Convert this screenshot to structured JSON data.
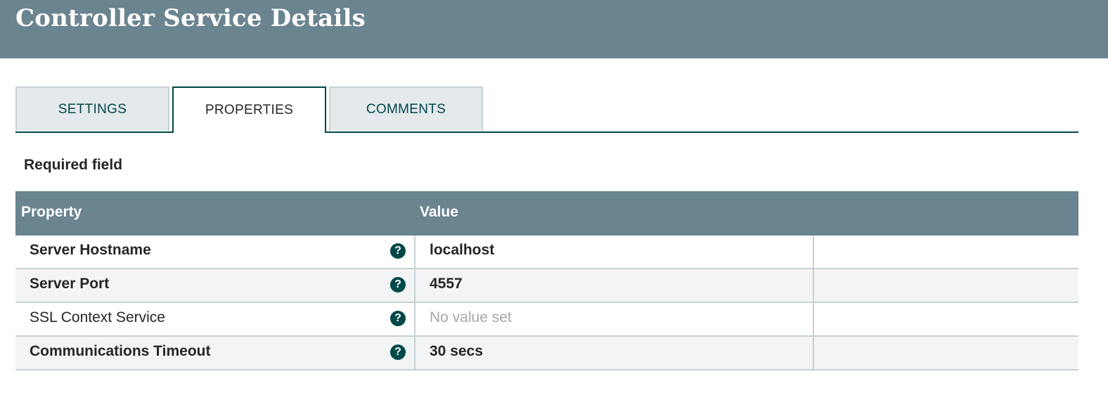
{
  "header": {
    "title": "Controller Service Details"
  },
  "tabs": [
    {
      "label": "SETTINGS",
      "active": false
    },
    {
      "label": "PROPERTIES",
      "active": true
    },
    {
      "label": "COMMENTS",
      "active": false
    }
  ],
  "required_field_label": "Required field",
  "table": {
    "columns": [
      "Property",
      "Value"
    ],
    "rows": [
      {
        "property": "Server Hostname",
        "required": true,
        "value": "localhost",
        "value_set": true
      },
      {
        "property": "Server Port",
        "required": true,
        "value": "4557",
        "value_set": true
      },
      {
        "property": "SSL Context Service",
        "required": false,
        "value": "No value set",
        "value_set": false
      },
      {
        "property": "Communications Timeout",
        "required": true,
        "value": "30 secs",
        "value_set": true
      }
    ]
  },
  "icons": {
    "help": "question-circle-icon"
  },
  "colors": {
    "header_bg": "#6a8490",
    "accent": "#004849",
    "tab_inactive_bg": "#e4e9ec",
    "row_alt_bg": "#f3f4f5"
  }
}
